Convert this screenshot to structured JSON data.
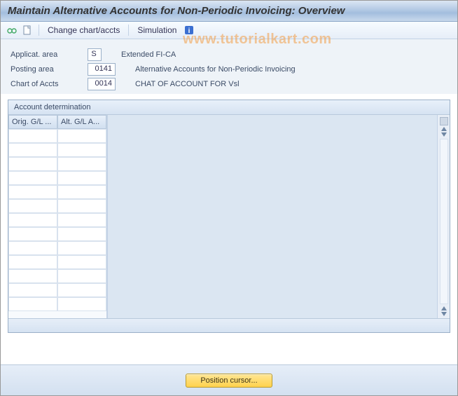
{
  "title": "Maintain Alternative Accounts for Non-Periodic Invoicing: Overview",
  "toolbar": {
    "change_chart": "Change chart/accts",
    "simulation": "Simulation"
  },
  "watermark": "www.tutorialkart.com",
  "form": {
    "applic_label": "Applicat. area",
    "applic_value": "S",
    "applic_desc": "Extended FI-CA",
    "posting_label": "Posting area",
    "posting_value": "0141",
    "posting_desc": "Alternative Accounts for Non-Periodic Invoicing",
    "chart_label": "Chart of Accts",
    "chart_value": "0014",
    "chart_desc": "CHAT OF ACCOUNT FOR Vsl"
  },
  "panel": {
    "title": "Account determination",
    "col1": "Orig. G/L ...",
    "col2": "Alt. G/L A..."
  },
  "bottom": {
    "position": "Position cursor..."
  }
}
